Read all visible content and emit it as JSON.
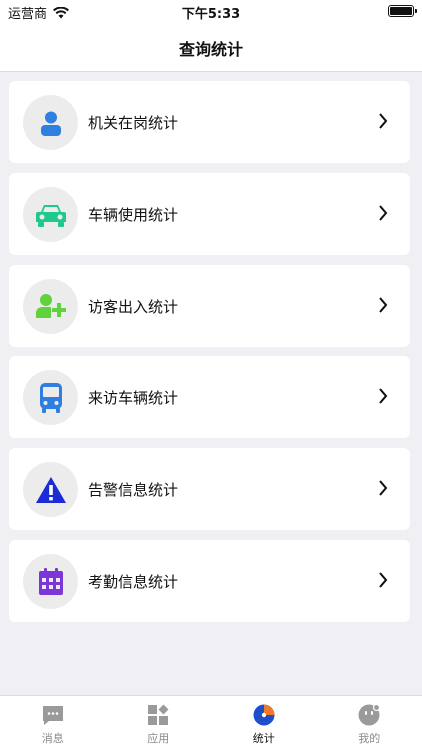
{
  "status": {
    "carrier": "运营商",
    "time": "下午5:33"
  },
  "nav": {
    "title": "查询统计"
  },
  "items": [
    {
      "label": "机关在岗统计",
      "icon": "person-icon",
      "color": "#2f7fe0"
    },
    {
      "label": "车辆使用统计",
      "icon": "car-icon",
      "color": "#1ec98a"
    },
    {
      "label": "访客出入统计",
      "icon": "add-person-icon",
      "color": "#5fd23c"
    },
    {
      "label": "来访车辆统计",
      "icon": "bus-icon",
      "color": "#2f7fe0"
    },
    {
      "label": "告警信息统计",
      "icon": "warning-icon",
      "color": "#1b2bd6"
    },
    {
      "label": "考勤信息统计",
      "icon": "calendar-icon",
      "color": "#7b36d8"
    }
  ],
  "tabs": [
    {
      "label": "消息",
      "icon": "message-icon",
      "active": false
    },
    {
      "label": "应用",
      "icon": "apps-icon",
      "active": false
    },
    {
      "label": "统计",
      "icon": "pie-chart-icon",
      "active": true
    },
    {
      "label": "我的",
      "icon": "profile-icon",
      "active": false
    }
  ]
}
